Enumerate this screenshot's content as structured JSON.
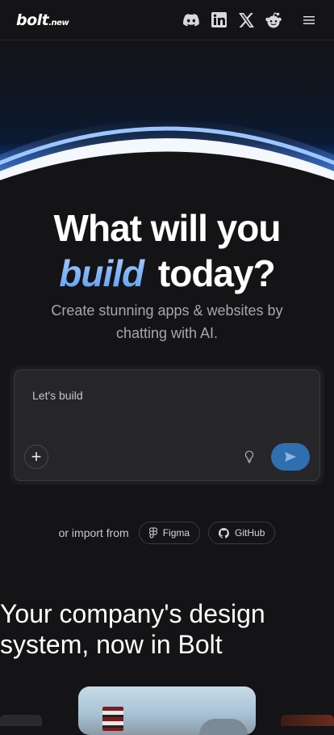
{
  "header": {
    "logo_text": "bolt",
    "logo_suffix": ".new",
    "icons": [
      "discord-icon",
      "linkedin-icon",
      "x-icon",
      "reddit-icon",
      "menu-icon"
    ]
  },
  "hero": {
    "title_line1": "What will you",
    "title_highlight": "build",
    "title_line2_rest": " today?",
    "subtitle": "Create stunning apps & websites by chatting with AI."
  },
  "prompt": {
    "placeholder": "Let's build",
    "value": "",
    "add_label": "+"
  },
  "import": {
    "label": "or import from",
    "figma_label": "Figma",
    "github_label": "GitHub"
  },
  "section": {
    "title": "Your company's design system, now in Bolt"
  },
  "colors": {
    "background": "#141416",
    "accent_blue": "#2f6fb0",
    "highlight_gradient_top": "#a9cdfd",
    "highlight_gradient_bottom": "#5b9df6"
  }
}
